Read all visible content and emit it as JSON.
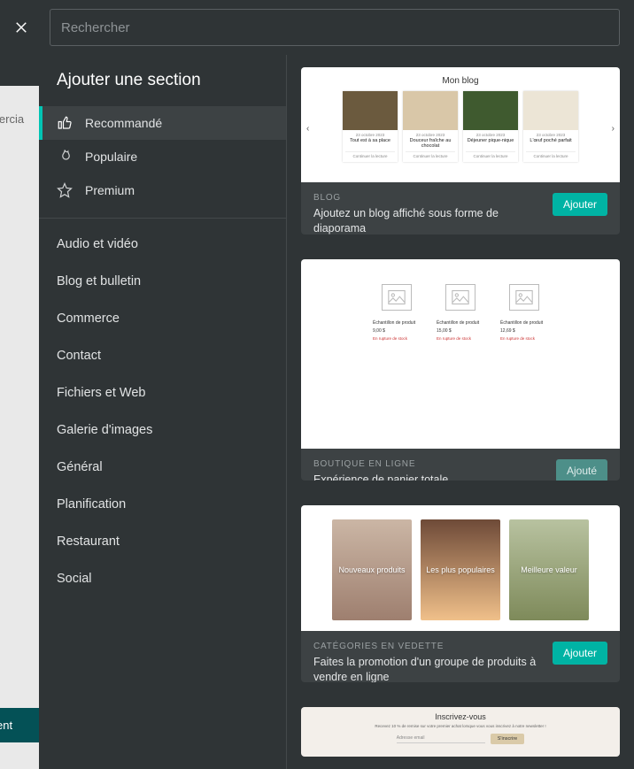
{
  "search": {
    "placeholder": "Rechercher"
  },
  "sidebar": {
    "title": "Ajouter une section",
    "pills": [
      {
        "label": "Recommandé",
        "icon": "thumbs-up-icon",
        "active": true
      },
      {
        "label": "Populaire",
        "icon": "flame-icon",
        "active": false
      },
      {
        "label": "Premium",
        "icon": "star-icon",
        "active": false
      }
    ],
    "categories": [
      "Audio et vidéo",
      "Blog et bulletin",
      "Commerce",
      "Contact",
      "Fichiers et Web",
      "Galerie d'images",
      "Général",
      "Planification",
      "Restaurant",
      "Social"
    ]
  },
  "cards": {
    "blog": {
      "preview_title": "Mon blog",
      "posts": [
        {
          "date": "23 octobre 2023",
          "title": "Tout est à sa place",
          "link": "Continuer la lecture",
          "bg": "#6b5a3e"
        },
        {
          "date": "23 octobre 2023",
          "title": "Douceur fraîche au chocolat",
          "link": "Continuer la lecture",
          "bg": "#d9c7a8"
        },
        {
          "date": "23 octobre 2023",
          "title": "Déjeuner pique-nique",
          "link": "Continuer la lecture",
          "bg": "#3f5a2f"
        },
        {
          "date": "23 octobre 2023",
          "title": "L'œuf poché parfait",
          "link": "Continuer la lecture",
          "bg": "#ece5d6"
        }
      ],
      "label": "BLOG",
      "desc": "Ajoutez un blog affiché sous forme de diaporama",
      "button": "Ajouter"
    },
    "shop": {
      "products": [
        {
          "name": "Échantillon de produit",
          "price": "9,00 $",
          "link": "En rupture de stock"
        },
        {
          "name": "Échantillon de produit",
          "price": "15,00 $",
          "link": "En rupture de stock"
        },
        {
          "name": "Échantillon de produit",
          "price": "12,69 $",
          "link": "En rupture de stock"
        }
      ],
      "label": "BOUTIQUE EN LIGNE",
      "desc": "Expérience de panier totale",
      "button": "Ajouté"
    },
    "cats": {
      "tiles": [
        {
          "label": "Nouveaux produits",
          "bg": "linear-gradient(#cbb6a5,#9e7f6f)"
        },
        {
          "label": "Les plus populaires",
          "bg": "linear-gradient(#6e4a38,#f0c08a)"
        },
        {
          "label": "Meilleure valeur",
          "bg": "linear-gradient(#b8c2a0,#7e8a5a)"
        }
      ],
      "label": "CATÉGORIES EN VEDETTE",
      "desc": "Faites la promotion d'un groupe de produits à vendre en ligne",
      "button": "Ajouter"
    },
    "news": {
      "title": "Inscrivez-vous",
      "subtitle": "Recevez 10 % de remise sur votre premier achat lorsque vous vous inscrivez à notre newsletter !",
      "field": "Adresse email",
      "submit": "S'inscrire"
    }
  },
  "bg": {
    "t1": "ommercia",
    "t2": "oment"
  }
}
